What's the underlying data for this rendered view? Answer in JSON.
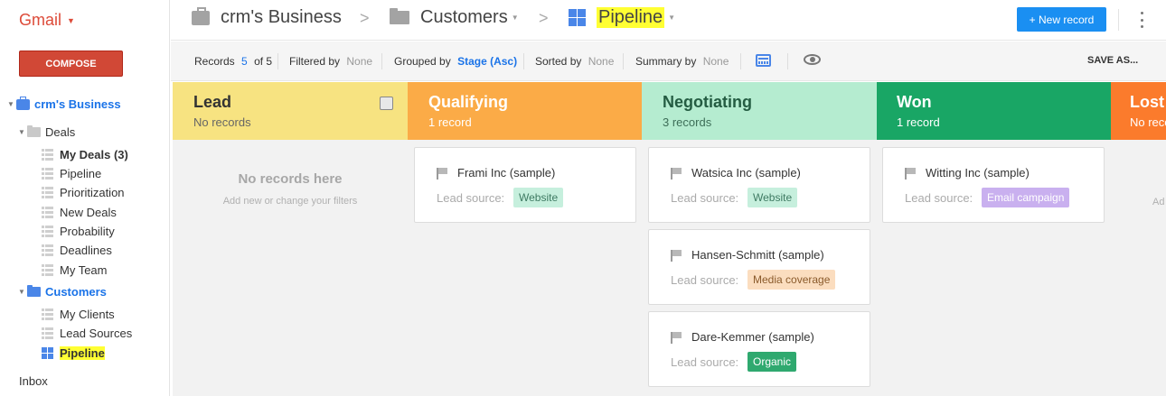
{
  "app": {
    "name": "Gmail",
    "compose_label": "COMPOSE"
  },
  "sidebar": {
    "workspace": "crm's Business",
    "deals_folder": "Deals",
    "deals_items": [
      "My Deals (3)",
      "Pipeline",
      "Prioritization",
      "New Deals",
      "Probability",
      "Deadlines",
      "My Team"
    ],
    "customers_folder": "Customers",
    "customers_items": [
      "My Clients",
      "Lead Sources",
      "Pipeline"
    ],
    "inbox": "Inbox"
  },
  "header": {
    "breadcrumb": [
      "crm's Business",
      "Customers",
      "Pipeline"
    ],
    "separator": ">",
    "new_record_label": "+ New record"
  },
  "toolbar": {
    "records_label": "Records",
    "records_shown": "5",
    "records_total": "of 5",
    "filtered_label": "Filtered by",
    "filtered_value": "None",
    "grouped_label": "Grouped by",
    "grouped_value": "Stage (Asc)",
    "sorted_label": "Sorted by",
    "sorted_value": "None",
    "summary_label": "Summary by",
    "summary_value": "None",
    "save_as_label": "SAVE AS..."
  },
  "board": {
    "stages": [
      {
        "name": "Lead",
        "count": "No records"
      },
      {
        "name": "Qualifying",
        "count": "1 record"
      },
      {
        "name": "Negotiating",
        "count": "3 records"
      },
      {
        "name": "Won",
        "count": "1 record"
      },
      {
        "name": "Lost",
        "count": "No records"
      }
    ],
    "empty_title": "No records here",
    "empty_subtitle": "Add new or change your filters",
    "lost_partial": "Ad",
    "lead_source_label": "Lead source:",
    "cards": [
      {
        "title": "Frami Inc (sample)",
        "source": "Website"
      },
      {
        "title": "Watsica Inc (sample)",
        "source": "Website"
      },
      {
        "title": "Hansen-Schmitt (sample)",
        "source": "Media coverage"
      },
      {
        "title": "Dare-Kemmer (sample)",
        "source": "Organic"
      },
      {
        "title": "Witting Inc (sample)",
        "source": "Email campaign"
      }
    ]
  },
  "colors": {
    "lead": "#f7e381",
    "qualifying": "#fbab47",
    "negotiating": "#b5ecd0",
    "won": "#19a665",
    "lost": "#fb7b2c",
    "accent": "#1a8ff2",
    "compose": "#d14836"
  }
}
